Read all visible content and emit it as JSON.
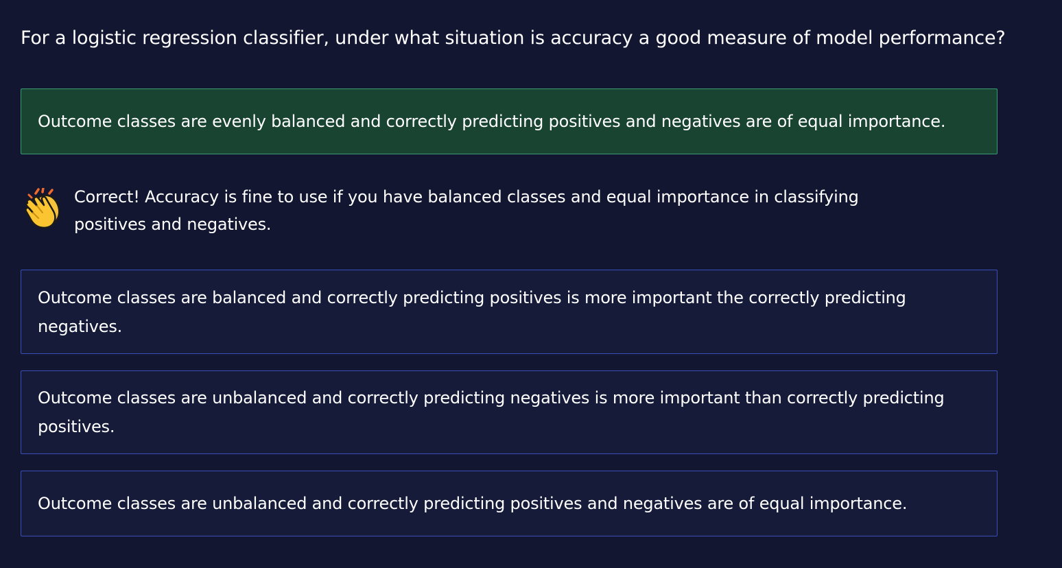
{
  "question": {
    "text": "For a logistic regression classifier, under what situation is accuracy a good measure of model performance?"
  },
  "options": [
    {
      "text": "Outcome classes are evenly balanced and correctly predicting positives and negatives are of equal importance.",
      "state": "correct",
      "accent": "#194432"
    },
    {
      "text": "Outcome classes are balanced and correctly predicting positives is more important the correctly predicting negatives.",
      "state": "default"
    },
    {
      "text": "Outcome classes are unbalanced and correctly predicting negatives is more important than correctly predicting positives.",
      "state": "default"
    },
    {
      "text": "Outcome classes are unbalanced and correctly predicting positives and negatives are of equal importance.",
      "state": "default"
    }
  ],
  "feedback": {
    "icon": "clapping-hands-icon",
    "text": "Correct! Accuracy is fine to use if you have balanced classes and equal importance in classifying positives and negatives."
  },
  "colors": {
    "background": "#121631",
    "option_border": "#3a4eba",
    "correct_border": "#3a9a72"
  }
}
